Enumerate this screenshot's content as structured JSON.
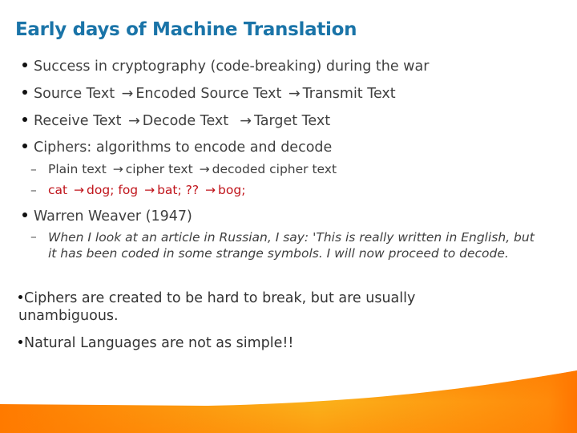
{
  "slide": {
    "title": "Early days of Machine Translation",
    "bullets": [
      {
        "text": "Success in cryptography (code-breaking) during the war"
      },
      {
        "parts": [
          "Source Text",
          "Encoded Source Text",
          "Transmit Text"
        ]
      },
      {
        "parts": [
          "Receive Text",
          "Decode Text",
          "Target Text"
        ]
      },
      {
        "text": "Ciphers: algorithms to encode and decode",
        "sub": [
          {
            "parts": [
              "Plain text",
              "cipher text",
              "decoded cipher text"
            ]
          },
          {
            "parts": [
              "cat",
              "dog; fog",
              "bat; ??",
              "bog;"
            ],
            "color": "#c0141b"
          }
        ]
      },
      {
        "text": "Warren Weaver (1947)",
        "sub": [
          {
            "text": "When I look at an article in Russian, I say: 'This is really written in English, but it has been coded in some strange symbols. I will now proceed to decode."
          }
        ]
      }
    ],
    "paragraphs": [
      "Ciphers are created to be hard to break, but are usually unambiguous.",
      "Natural Languages are not as simple!!"
    ],
    "arrow_glyph": "→",
    "dash_glyph": "–",
    "colors": {
      "title": "#1a74a8",
      "body": "#3f3f3f",
      "highlight": "#c0141b",
      "footer_orange": "#ff7a00",
      "footer_yellow": "#fbb11a"
    }
  }
}
